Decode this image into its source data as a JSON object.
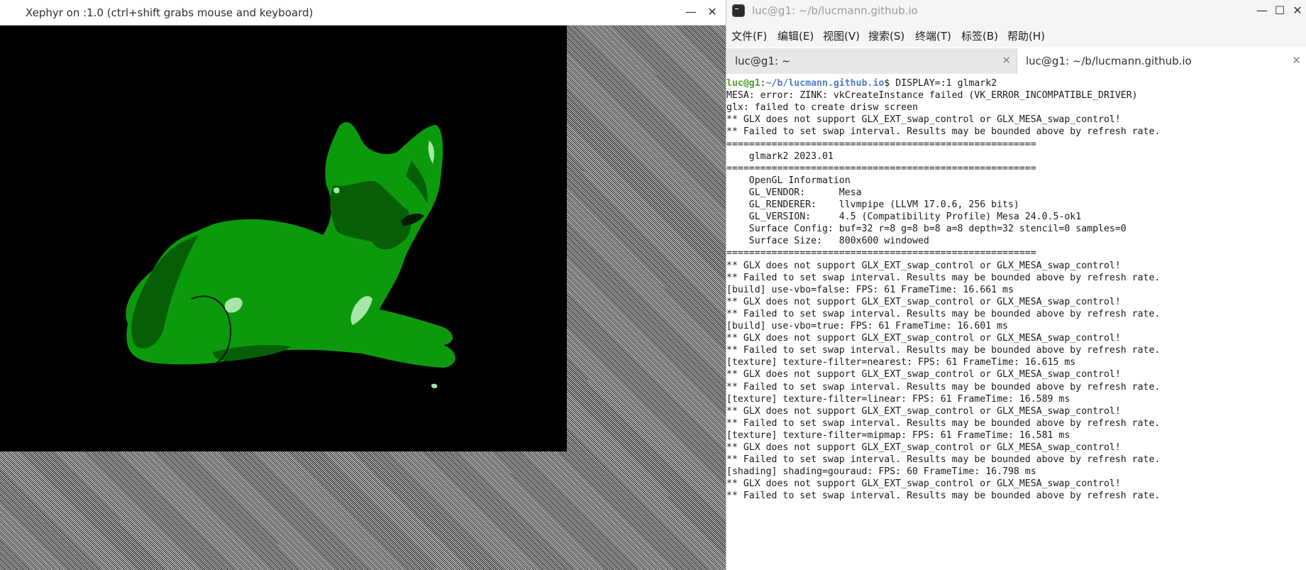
{
  "xephyr": {
    "title": "Xephyr on :1.0 (ctrl+shift grabs mouse and keyboard)",
    "minimize_glyph": "—",
    "close_glyph": "✕",
    "model_color": "#0b9a0b"
  },
  "terminal": {
    "title": "luc@g1: ~/b/lucmann.github.io",
    "window_buttons": {
      "minimize": "—",
      "maximize": "☐",
      "close": "✕"
    },
    "menu": [
      "文件(F)",
      "编辑(E)",
      "视图(V)",
      "搜索(S)",
      "终端(T)",
      "标签(B)",
      "帮助(H)"
    ],
    "tabs": [
      {
        "label": "luc@g1: ~",
        "close": "✕",
        "active": false
      },
      {
        "label": "luc@g1: ~/b/lucmann.github.io",
        "close": "✕",
        "active": true
      }
    ],
    "prompt": {
      "user_host": "luc@g1",
      "sep": ":",
      "path": "~/b/lucmann.github.io",
      "command": "$ DISPLAY=:1 glmark2"
    },
    "lines": [
      "MESA: error: ZINK: vkCreateInstance failed (VK_ERROR_INCOMPATIBLE_DRIVER)",
      "glx: failed to create drisw screen",
      "** GLX does not support GLX_EXT_swap_control or GLX_MESA_swap_control!",
      "** Failed to set swap interval. Results may be bounded above by refresh rate.",
      "=======================================================",
      "    glmark2 2023.01",
      "=======================================================",
      "    OpenGL Information",
      "    GL_VENDOR:      Mesa",
      "    GL_RENDERER:    llvmpipe (LLVM 17.0.6, 256 bits)",
      "    GL_VERSION:     4.5 (Compatibility Profile) Mesa 24.0.5-ok1",
      "    Surface Config: buf=32 r=8 g=8 b=8 a=8 depth=32 stencil=0 samples=0",
      "    Surface Size:   800x600 windowed",
      "=======================================================",
      "** GLX does not support GLX_EXT_swap_control or GLX_MESA_swap_control!",
      "** Failed to set swap interval. Results may be bounded above by refresh rate.",
      "[build] use-vbo=false: FPS: 61 FrameTime: 16.661 ms",
      "** GLX does not support GLX_EXT_swap_control or GLX_MESA_swap_control!",
      "** Failed to set swap interval. Results may be bounded above by refresh rate.",
      "[build] use-vbo=true: FPS: 61 FrameTime: 16.601 ms",
      "** GLX does not support GLX_EXT_swap_control or GLX_MESA_swap_control!",
      "** Failed to set swap interval. Results may be bounded above by refresh rate.",
      "[texture] texture-filter=nearest: FPS: 61 FrameTime: 16.615 ms",
      "** GLX does not support GLX_EXT_swap_control or GLX_MESA_swap_control!",
      "** Failed to set swap interval. Results may be bounded above by refresh rate.",
      "[texture] texture-filter=linear: FPS: 61 FrameTime: 16.589 ms",
      "** GLX does not support GLX_EXT_swap_control or GLX_MESA_swap_control!",
      "** Failed to set swap interval. Results may be bounded above by refresh rate.",
      "[texture] texture-filter=mipmap: FPS: 61 FrameTime: 16.581 ms",
      "** GLX does not support GLX_EXT_swap_control or GLX_MESA_swap_control!",
      "** Failed to set swap interval. Results may be bounded above by refresh rate.",
      "[shading] shading=gouraud: FPS: 60 FrameTime: 16.798 ms",
      "** GLX does not support GLX_EXT_swap_control or GLX_MESA_swap_control!",
      "** Failed to set swap interval. Results may be bounded above by refresh rate."
    ]
  }
}
